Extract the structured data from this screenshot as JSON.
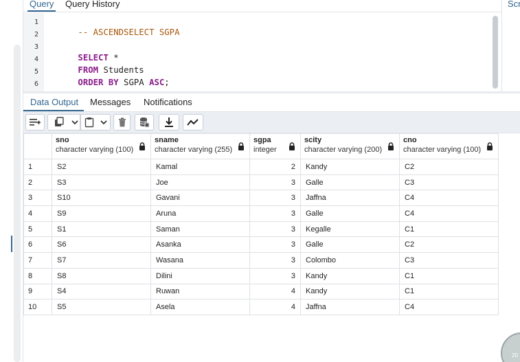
{
  "query_tabs": [
    {
      "label": "Query",
      "active": true
    },
    {
      "label": "Query History",
      "active": false
    }
  ],
  "side_tab": {
    "label": "Scr"
  },
  "editor": {
    "line_numbers": [
      "1",
      "2",
      "3",
      "4",
      "5",
      "6"
    ],
    "lines": [
      {
        "comment": "-- ASCENDSELECT SGPA"
      },
      {},
      {
        "kw": "SELECT",
        "rest": " *"
      },
      {
        "kw": "FROM",
        "rest": " Students"
      },
      {
        "kw": "ORDER BY",
        "rest": " SGPA ",
        "kw2": "ASC",
        "tail": ";"
      },
      {}
    ]
  },
  "output_tabs": [
    {
      "label": "Data Output",
      "active": true
    },
    {
      "label": "Messages",
      "active": false
    },
    {
      "label": "Notifications",
      "active": false
    }
  ],
  "toolbar": {
    "buttons": [
      "add-row-icon",
      "copy-icon",
      "chevron-down-icon",
      "paste-icon",
      "chevron-down-icon",
      "delete-icon",
      "save-data-icon",
      "download-icon",
      "graph-icon"
    ]
  },
  "grid": {
    "columns": [
      {
        "name": "sno",
        "type": "character varying (100)"
      },
      {
        "name": "sname",
        "type": "character varying (255)"
      },
      {
        "name": "sgpa",
        "type": "integer"
      },
      {
        "name": "scity",
        "type": "character varying (200)"
      },
      {
        "name": "cno",
        "type": "character varying (100)"
      }
    ],
    "rows": [
      {
        "n": "1",
        "cells": [
          "S2",
          "Kamal",
          "2",
          "Kandy",
          "C2"
        ]
      },
      {
        "n": "2",
        "cells": [
          "S3",
          "Joe",
          "3",
          "Galle",
          "C3"
        ]
      },
      {
        "n": "3",
        "cells": [
          "S10",
          "Gavani",
          "3",
          "Jaffna",
          "C4"
        ]
      },
      {
        "n": "4",
        "cells": [
          "S9",
          "Aruna",
          "3",
          "Galle",
          "C4"
        ]
      },
      {
        "n": "5",
        "cells": [
          "S1",
          "Saman",
          "3",
          "Kegalle",
          "C1"
        ]
      },
      {
        "n": "6",
        "cells": [
          "S6",
          "Asanka",
          "3",
          "Galle",
          "C2"
        ]
      },
      {
        "n": "7",
        "cells": [
          "S7",
          "Wasana",
          "3",
          "Colombo",
          "C3"
        ]
      },
      {
        "n": "8",
        "cells": [
          "S8",
          "Dilini",
          "3",
          "Kandy",
          "C1"
        ]
      },
      {
        "n": "9",
        "cells": [
          "S4",
          "Ruwan",
          "4",
          "Kandy",
          "C1"
        ]
      },
      {
        "n": "10",
        "cells": [
          "S5",
          "Asela",
          "4",
          "Jaffna",
          "C4"
        ]
      }
    ]
  },
  "logo": {
    "text": "20"
  },
  "colors": {
    "accent": "#326690",
    "keyword": "#8a1c8a",
    "comment": "#a9560b"
  }
}
